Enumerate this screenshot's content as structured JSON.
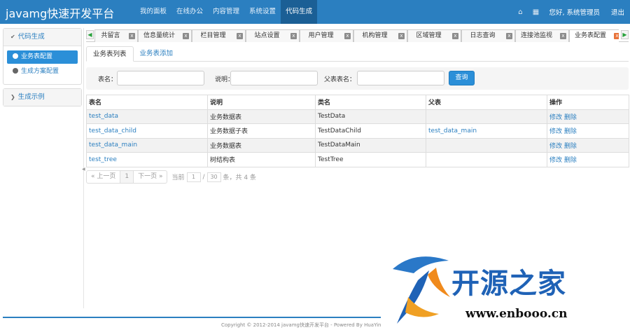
{
  "app": {
    "title": "javamg快速开发平台"
  },
  "topnav": {
    "items": [
      "我的面板",
      "在线办公",
      "内容管理",
      "系统设置",
      "代码生成"
    ],
    "greeting": "您好, 系统管理员",
    "logout": "退出"
  },
  "sidebar": {
    "group1": {
      "title": "代码生成",
      "items": [
        "业务表配置",
        "生成方案配置"
      ]
    },
    "group2": {
      "title": "生成示例"
    }
  },
  "tabs": [
    "共留言",
    "信息量统计",
    "栏目管理",
    "站点设置",
    "用户管理",
    "机构管理",
    "区域管理",
    "日志查询",
    "连接池监视",
    "业务表配置"
  ],
  "subtabs": [
    "业务表列表",
    "业务表添加"
  ],
  "search": {
    "table_name_label": "表名：",
    "comment_label": "说明：",
    "parent_label": "父表表名：",
    "button": "查询"
  },
  "table": {
    "headers": [
      "表名",
      "说明",
      "类名",
      "父表",
      "操作"
    ],
    "rows": [
      {
        "name": "test_data",
        "comment": "业务数据表",
        "class": "TestData",
        "parent": "",
        "edit": "修改",
        "del": "删除"
      },
      {
        "name": "test_data_child",
        "comment": "业务数据子表",
        "class": "TestDataChild",
        "parent": "test_data_main",
        "edit": "修改",
        "del": "删除"
      },
      {
        "name": "test_data_main",
        "comment": "业务数据表",
        "class": "TestDataMain",
        "parent": "",
        "edit": "修改",
        "del": "删除"
      },
      {
        "name": "test_tree",
        "comment": "树结构表",
        "class": "TestTree",
        "parent": "",
        "edit": "修改",
        "del": "删除"
      }
    ]
  },
  "pager": {
    "prev": "« 上一页",
    "page": "1",
    "next": "下一页 »",
    "current_label": "当前",
    "current_value": "1",
    "slash": "/",
    "page_size": "30",
    "summary": "条，共 4 条"
  },
  "footer": {
    "text": "Copyright © 2012-2014 javamg快速开发平台 - Powered By HuaYin"
  },
  "watermark": {
    "title": "开源之家",
    "url": "www.enbooo.cn"
  },
  "colors": {
    "primary": "#2b7fc0",
    "nav_active": "#1b5f95",
    "tab_close_active": "#e8733a"
  }
}
